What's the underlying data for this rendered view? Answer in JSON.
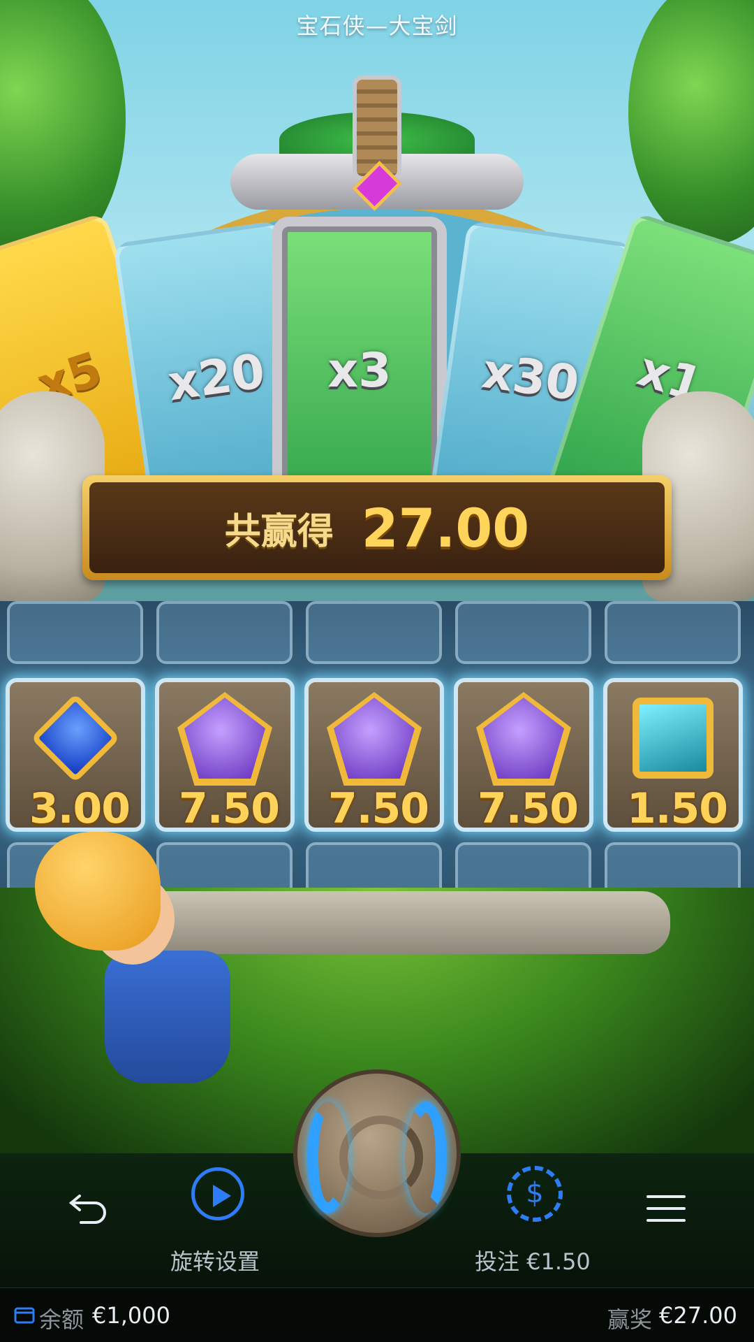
{
  "header": {
    "title": "宝石侠—大宝剑"
  },
  "wheel": {
    "segments": [
      "x5",
      "x20",
      "x3",
      "x30",
      "x1"
    ],
    "selected": "x3"
  },
  "win_banner": {
    "label": "共赢得",
    "value": "27.00"
  },
  "reels": {
    "cells": [
      {
        "gem": "blue-diamond",
        "value": "3.00"
      },
      {
        "gem": "purple-pentagon",
        "value": "7.50"
      },
      {
        "gem": "purple-pentagon",
        "value": "7.50"
      },
      {
        "gem": "purple-pentagon",
        "value": "7.50"
      },
      {
        "gem": "cyan-square",
        "value": "1.50"
      }
    ]
  },
  "controls": {
    "back_icon": "back-arrow-icon",
    "turbo_label": "旋转设置",
    "bet_label": "投注 €1.50",
    "menu_icon": "menu-icon"
  },
  "footer": {
    "balance_label": "余额",
    "balance_value": "€1,000",
    "win_label": "赢奖",
    "win_value": "€27.00"
  },
  "colors": {
    "accent": "#2e7cf6",
    "gold": "#ffd45a",
    "banner_bg": "#4a2c14"
  }
}
